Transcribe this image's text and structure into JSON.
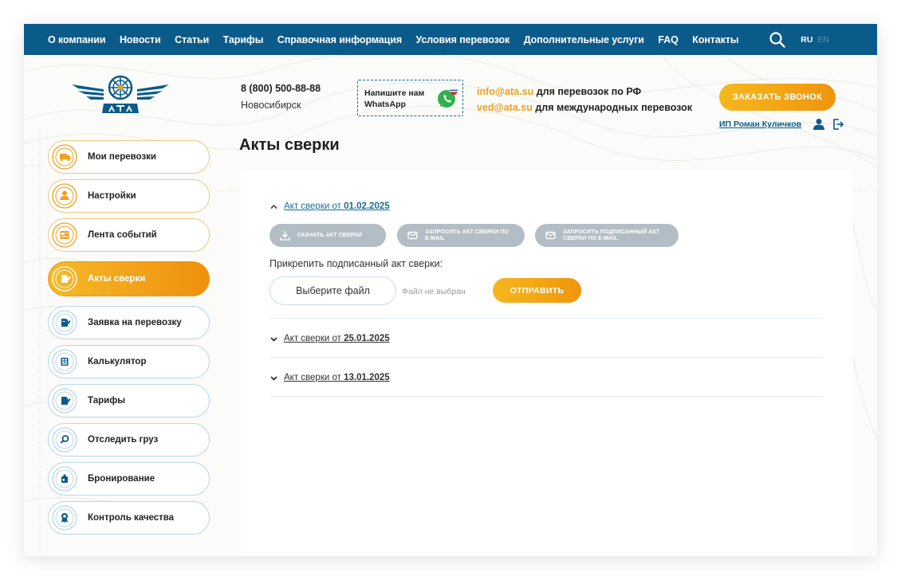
{
  "nav": {
    "items": [
      "О компании",
      "Новости",
      "Статьи",
      "Тарифы",
      "Справочная информация",
      "Условия перевозок",
      "Дополнительные услуги",
      "FAQ",
      "Контакты"
    ],
    "lang_active": "RU",
    "lang_inactive": "EN"
  },
  "header": {
    "phone": "8 (800) 500-88-88",
    "city": "Новосибирск",
    "whatsapp_text": "Напишите нам WhatsApp",
    "email1": "info@ata.su",
    "email1_desc": " для перевозок по РФ",
    "email2": "ved@ata.su",
    "email2_desc": " для международных перевозок",
    "callback_label": "ЗАКАЗАТЬ ЗВОНОК",
    "user_name": "ИП Роман Куличков"
  },
  "sidebar": {
    "items": [
      {
        "label": "Мои перевозки",
        "icon": "truck-icon"
      },
      {
        "label": "Настройки",
        "icon": "user-settings-icon"
      },
      {
        "label": "Лента событий",
        "icon": "news-feed-icon"
      },
      {
        "label": "Акты сверки",
        "icon": "document-pen-icon"
      },
      {
        "label": "Заявка на перевозку",
        "icon": "request-form-icon"
      },
      {
        "label": "Калькулятор",
        "icon": "calculator-icon"
      },
      {
        "label": "Тарифы",
        "icon": "tariffs-icon"
      },
      {
        "label": "Отследить груз",
        "icon": "track-cargo-icon"
      },
      {
        "label": "Бронирование",
        "icon": "booking-icon"
      },
      {
        "label": "Контроль качества",
        "icon": "quality-control-icon"
      }
    ]
  },
  "main": {
    "title": "Акты сверки",
    "acts": [
      {
        "prefix": "Акт сверки от ",
        "date": "01.02.2025"
      },
      {
        "prefix": "Акт сверки от ",
        "date": "25.01.2025"
      },
      {
        "prefix": "Акт сверки от ",
        "date": "13.01.2025"
      }
    ],
    "download_label": "СКАЧАТЬ АКТ СВЕРКИ",
    "request_email_label": "ЗАПРОСИТЬ АКТ СВЕРКИ ПО E-MAIL",
    "request_signed_label": "ЗАПРОСИТЬ ПОДПИСАННЫЙ АКТ СВЕРКИ ПО E-MAIL",
    "attach_label": "Прикрепить подписанный акт сверки:",
    "choose_file_label": "Выберите файл",
    "no_file_label": "Файл не выбран",
    "send_label": "ОТПРАВИТЬ"
  },
  "colors": {
    "nav_bg": "#0b5b8a",
    "accent_orange": "#f0a11d",
    "button_gray": "#b3bdc6",
    "link_blue": "#1b6b9a"
  }
}
